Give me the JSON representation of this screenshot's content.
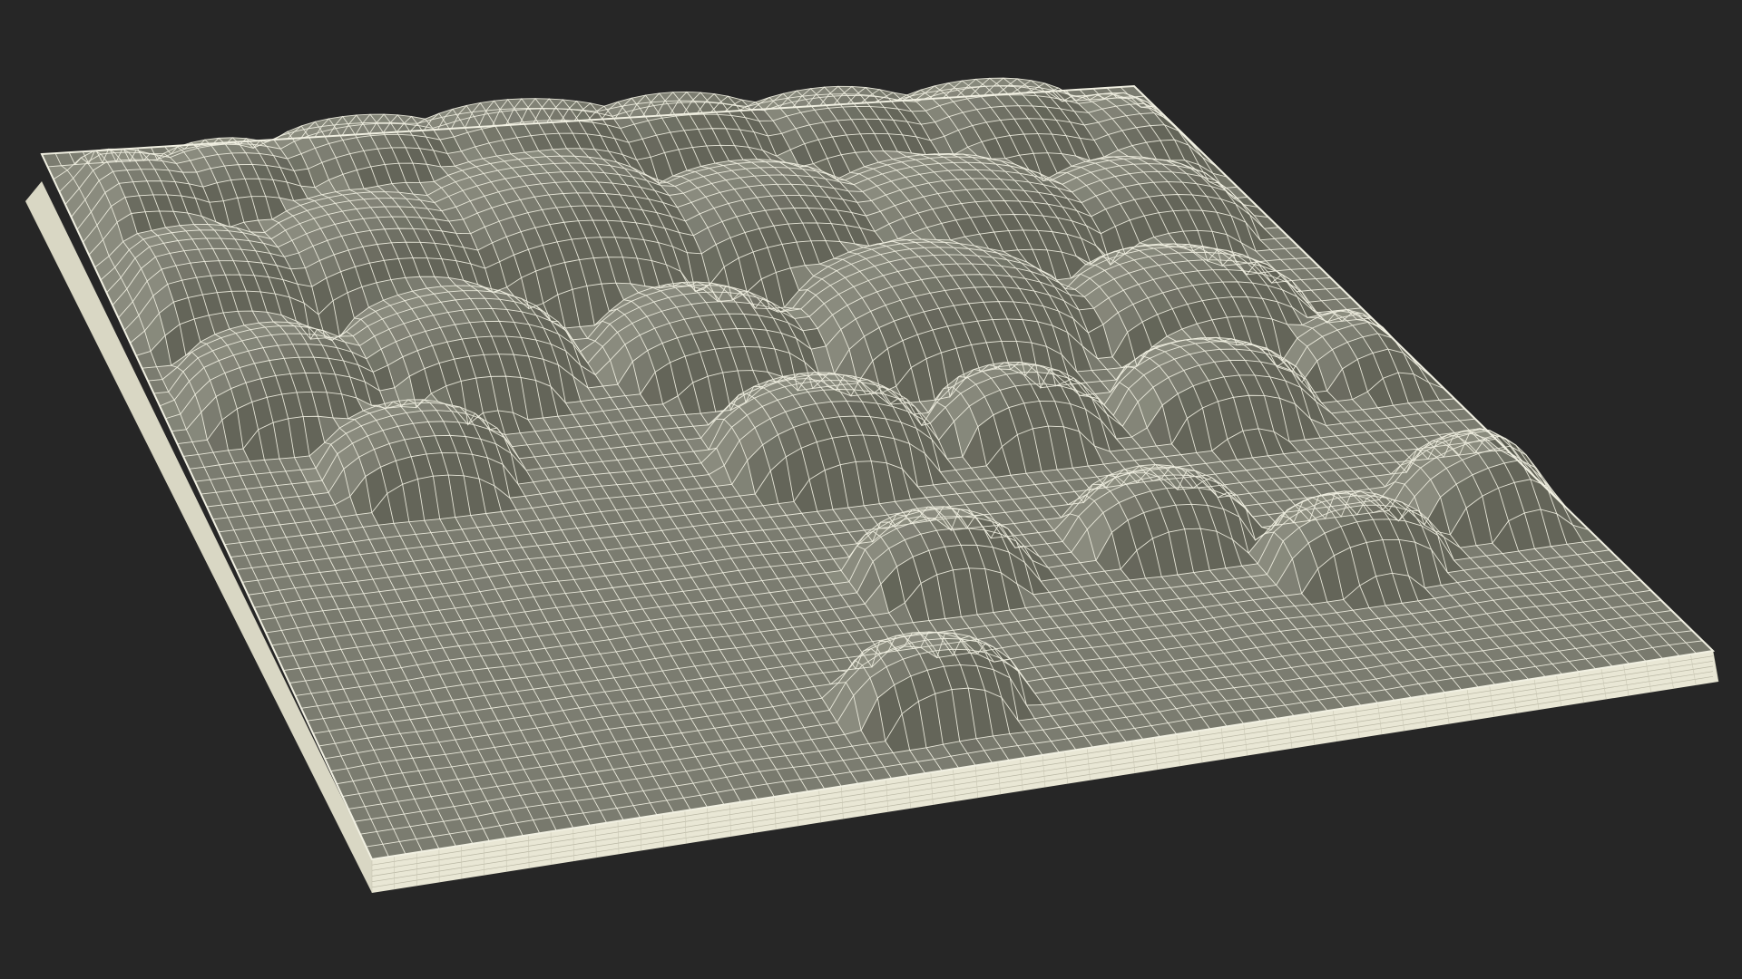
{
  "scene": {
    "subject": "wireframe-terrain-tile",
    "render_style": "wireframe-on-shaded",
    "colors": {
      "background": "#262626",
      "surface": "#7b7c70",
      "surface_dark": "#626357",
      "wire": "#f1f0e2",
      "base_side_front": "#e9e7d5",
      "base_side_left": "#d9d7c4"
    },
    "bumps": [
      {
        "u": 0.05,
        "v": 0.1,
        "r": 0.09,
        "h": 0.55
      },
      {
        "u": 0.15,
        "v": 0.08,
        "r": 0.08,
        "h": 0.5
      },
      {
        "u": 0.28,
        "v": 0.06,
        "r": 0.1,
        "h": 0.6
      },
      {
        "u": 0.42,
        "v": 0.05,
        "r": 0.12,
        "h": 0.65
      },
      {
        "u": 0.56,
        "v": 0.05,
        "r": 0.1,
        "h": 0.6
      },
      {
        "u": 0.7,
        "v": 0.06,
        "r": 0.1,
        "h": 0.55
      },
      {
        "u": 0.84,
        "v": 0.07,
        "r": 0.1,
        "h": 0.55
      },
      {
        "u": 0.95,
        "v": 0.1,
        "r": 0.08,
        "h": 0.45
      },
      {
        "u": 0.08,
        "v": 0.22,
        "r": 0.1,
        "h": 0.55
      },
      {
        "u": 0.24,
        "v": 0.2,
        "r": 0.11,
        "h": 0.6
      },
      {
        "u": 0.4,
        "v": 0.18,
        "r": 0.13,
        "h": 0.7
      },
      {
        "u": 0.58,
        "v": 0.2,
        "r": 0.11,
        "h": 0.6
      },
      {
        "u": 0.74,
        "v": 0.22,
        "r": 0.12,
        "h": 0.6
      },
      {
        "u": 0.9,
        "v": 0.22,
        "r": 0.09,
        "h": 0.5
      },
      {
        "u": 0.1,
        "v": 0.36,
        "r": 0.09,
        "h": 0.5
      },
      {
        "u": 0.26,
        "v": 0.34,
        "r": 0.1,
        "h": 0.55
      },
      {
        "u": 0.46,
        "v": 0.36,
        "r": 0.09,
        "h": 0.5
      },
      {
        "u": 0.66,
        "v": 0.36,
        "r": 0.12,
        "h": 0.65
      },
      {
        "u": 0.86,
        "v": 0.38,
        "r": 0.1,
        "h": 0.55
      },
      {
        "u": 0.18,
        "v": 0.48,
        "r": 0.08,
        "h": 0.45
      },
      {
        "u": 0.5,
        "v": 0.52,
        "r": 0.09,
        "h": 0.55
      },
      {
        "u": 0.66,
        "v": 0.52,
        "r": 0.07,
        "h": 0.5
      },
      {
        "u": 0.82,
        "v": 0.52,
        "r": 0.08,
        "h": 0.5
      },
      {
        "u": 0.97,
        "v": 0.48,
        "r": 0.07,
        "h": 0.4
      },
      {
        "u": 0.52,
        "v": 0.72,
        "r": 0.07,
        "h": 0.45
      },
      {
        "u": 0.7,
        "v": 0.7,
        "r": 0.07,
        "h": 0.45
      },
      {
        "u": 0.82,
        "v": 0.78,
        "r": 0.07,
        "h": 0.45
      },
      {
        "u": 0.96,
        "v": 0.72,
        "r": 0.08,
        "h": 0.5
      },
      {
        "u": 0.45,
        "v": 0.9,
        "r": 0.07,
        "h": 0.45
      }
    ]
  }
}
